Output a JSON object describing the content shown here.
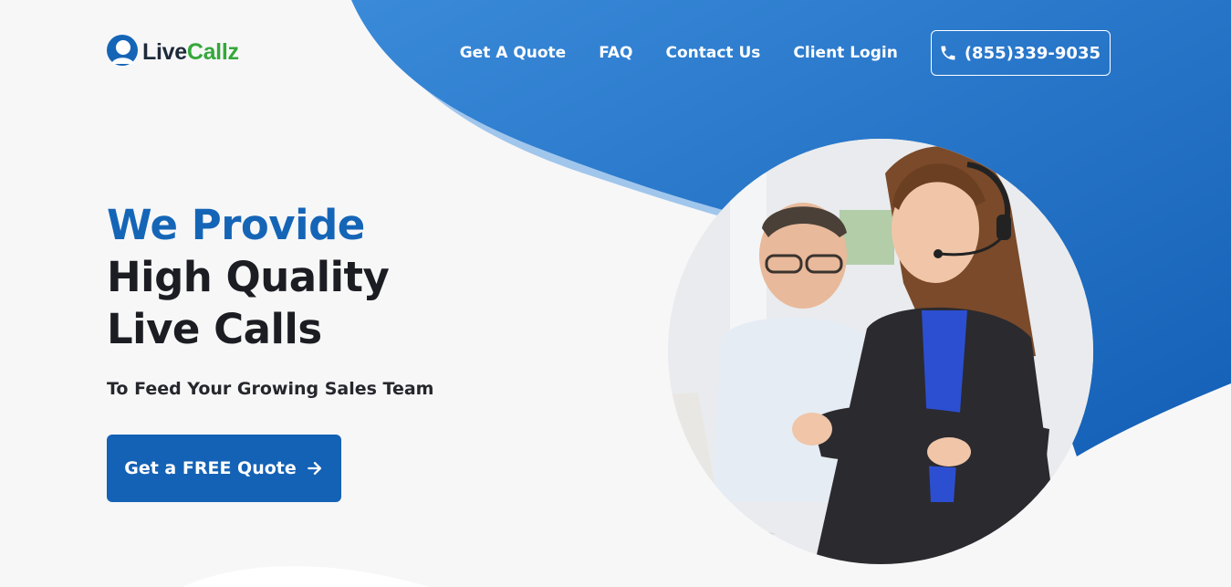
{
  "brand": {
    "name_part1": "Live",
    "name_part2": "Callz",
    "primary_color": "#1565b7",
    "accent_green": "#35a83a",
    "wave_color": "#1a6fca"
  },
  "nav": {
    "items": [
      {
        "label": "Get A Quote"
      },
      {
        "label": "FAQ"
      },
      {
        "label": "Contact Us"
      },
      {
        "label": "Client Login"
      }
    ],
    "phone": "(855)339-9035"
  },
  "hero": {
    "line1": "We Provide",
    "line2": "High Quality",
    "line3": "Live Calls",
    "subtitle": "To Feed Your Growing Sales Team",
    "cta_label": "Get a FREE Quote"
  },
  "icons": {
    "logo": "headset-person-icon",
    "phone": "phone-icon",
    "cta": "arrow-right-icon"
  }
}
